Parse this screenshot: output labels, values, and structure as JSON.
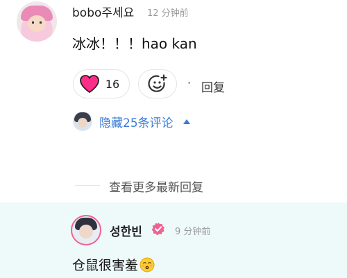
{
  "comment": {
    "username": "bobo주세요",
    "timestamp": "12 分钟前",
    "text": "冰冰！！！hao kan",
    "like_count": "16",
    "dot": "·",
    "reply_label": "回复",
    "like_color": "#ff2d8a"
  },
  "thread": {
    "toggle_label": "隐藏25条评论",
    "accent": "#3a7bd5"
  },
  "more": {
    "label": "查看更多最新回复"
  },
  "reply": {
    "username": "성한빈",
    "timestamp": "9 分钟前",
    "text": "仓鼠很害羞",
    "verified_color": "#f06292",
    "background": "#eefaf9",
    "emoji": "kissing-face-emoji"
  }
}
